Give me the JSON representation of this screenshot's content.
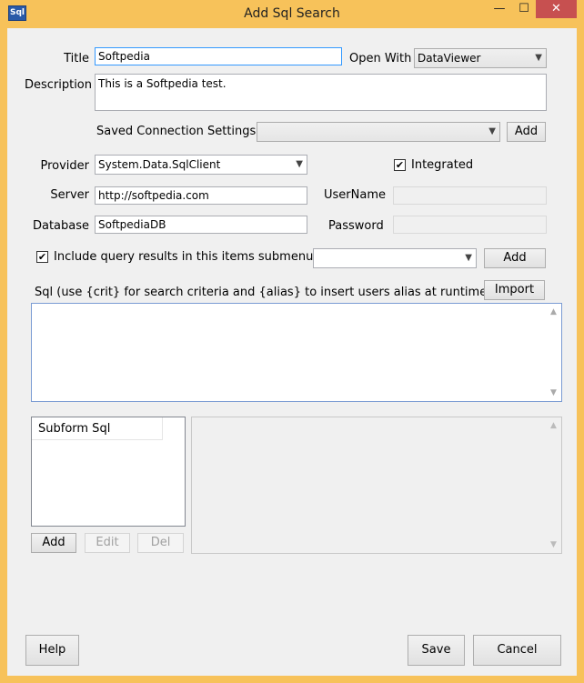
{
  "window": {
    "title": "Add Sql Search",
    "icon_label": "Sql",
    "minimize_glyph": "—",
    "maximize_glyph": "☐",
    "close_glyph": "✕"
  },
  "form": {
    "title_label": "Title",
    "title_value": "Softpedia",
    "open_with_label": "Open With",
    "open_with_value": "DataViewer",
    "description_label": "Description",
    "description_value": "This is a Softpedia test.",
    "saved_conn_label": "Saved Connection Settings",
    "saved_conn_value": "",
    "saved_conn_add": "Add",
    "provider_label": "Provider",
    "provider_value": "System.Data.SqlClient",
    "integrated_label": "Integrated",
    "integrated_checked": "✔",
    "server_label": "Server",
    "server_value": "http://softpedia.com",
    "username_label": "UserName",
    "database_label": "Database",
    "database_value": "SoftpediaDB",
    "password_label": "Password",
    "include_label": "Include query results in this items submenu",
    "include_checked": "✔",
    "submenu_value": "",
    "submenu_add": "Add",
    "sql_label": "Sql (use {crit} for search criteria and {alias} to insert users alias at runtime)",
    "import_label": "Import",
    "sql_value": ""
  },
  "subform": {
    "column_header": "Subform Sql",
    "add_label": "Add",
    "edit_label": "Edit",
    "del_label": "Del"
  },
  "footer": {
    "help_label": "Help",
    "save_label": "Save",
    "cancel_label": "Cancel"
  }
}
